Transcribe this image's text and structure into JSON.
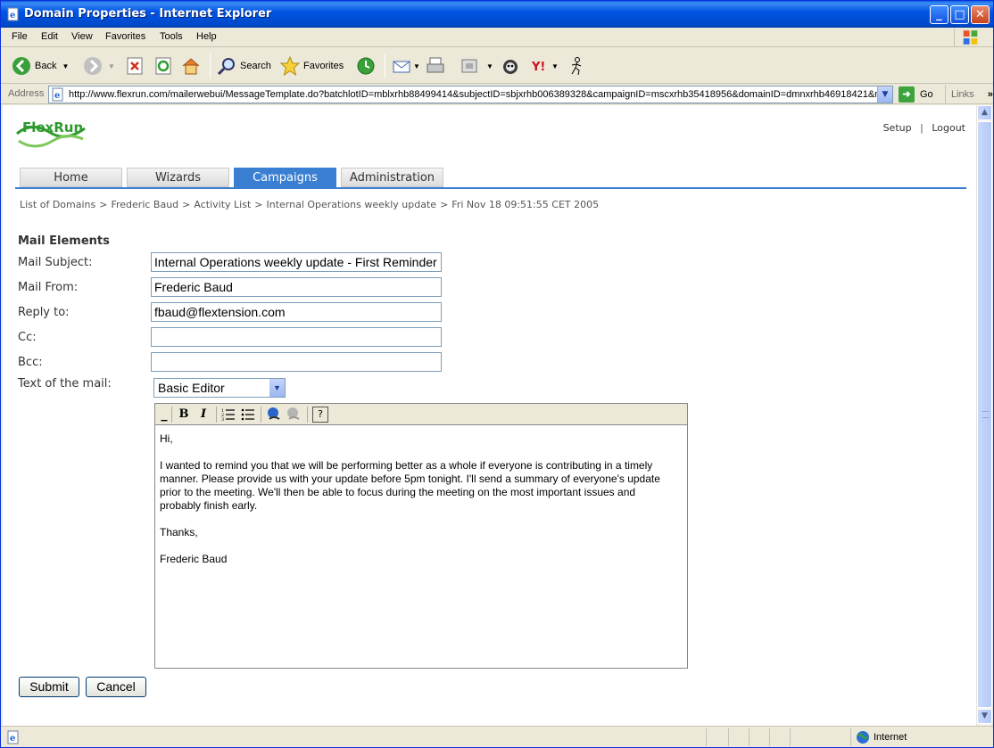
{
  "window": {
    "title": "Domain Properties - Internet Explorer"
  },
  "menu": [
    "File",
    "Edit",
    "View",
    "Favorites",
    "Tools",
    "Help"
  ],
  "toolbar": {
    "back": "Back",
    "search": "Search",
    "favorites": "Favorites"
  },
  "address": {
    "label": "Address",
    "url": "http://www.flexrun.com/mailerwebui/MessageTemplate.do?batchlotID=mblxrhb88499414&subjectID=sbjxrhb006389328&campaignID=mscxrhb35418956&domainID=dmnxrhb46918421&me",
    "go": "Go",
    "links": "Links",
    "more": "»"
  },
  "status": {
    "zone": "Internet"
  },
  "page": {
    "logo": "FlexRun",
    "top_links": {
      "setup": "Setup",
      "sep": "|",
      "logout": "Logout"
    },
    "tabs": [
      "Home",
      "Wizards",
      "Campaigns",
      "Administration"
    ],
    "active_tab": "Campaigns",
    "breadcrumb": [
      "List of Domains",
      "Frederic Baud",
      "Activity List",
      "Internal Operations weekly update",
      "Fri Nov 18 09:51:55 CET 2005"
    ],
    "breadcrumb_sep": ">",
    "section_title": "Mail Elements",
    "fields": {
      "subject": {
        "label": "Mail Subject:",
        "value": "Internal Operations weekly update - First Reminder"
      },
      "from": {
        "label": "Mail From:",
        "value": "Frederic Baud"
      },
      "reply_to": {
        "label": "Reply to:",
        "value": "fbaud@flextension.com"
      },
      "cc": {
        "label": "Cc:",
        "value": ""
      },
      "bcc": {
        "label": "Bcc:",
        "value": ""
      }
    },
    "text_label": "Text of the mail:",
    "editor_mode": "Basic Editor",
    "editor_toolbar": {
      "bold": "B",
      "italic": "I",
      "help": "?"
    },
    "body": {
      "greeting": "Hi,",
      "paragraph": "I wanted to remind you that we will be performing better as a whole if everyone is contributing in a timely manner. Please provide us with your update before 5pm tonight. I'll send a summary of everyone's update prior to the meeting. We'll then be able to focus during the meeting on the most important issues and probably finish early.",
      "closing": "Thanks,",
      "signature": "Frederic Baud"
    },
    "buttons": {
      "submit": "Submit",
      "cancel": "Cancel"
    }
  },
  "colors": {
    "accent": "#3a7fd1",
    "title_bar": "#0054e3",
    "logo_green": "#2e9a2e"
  }
}
